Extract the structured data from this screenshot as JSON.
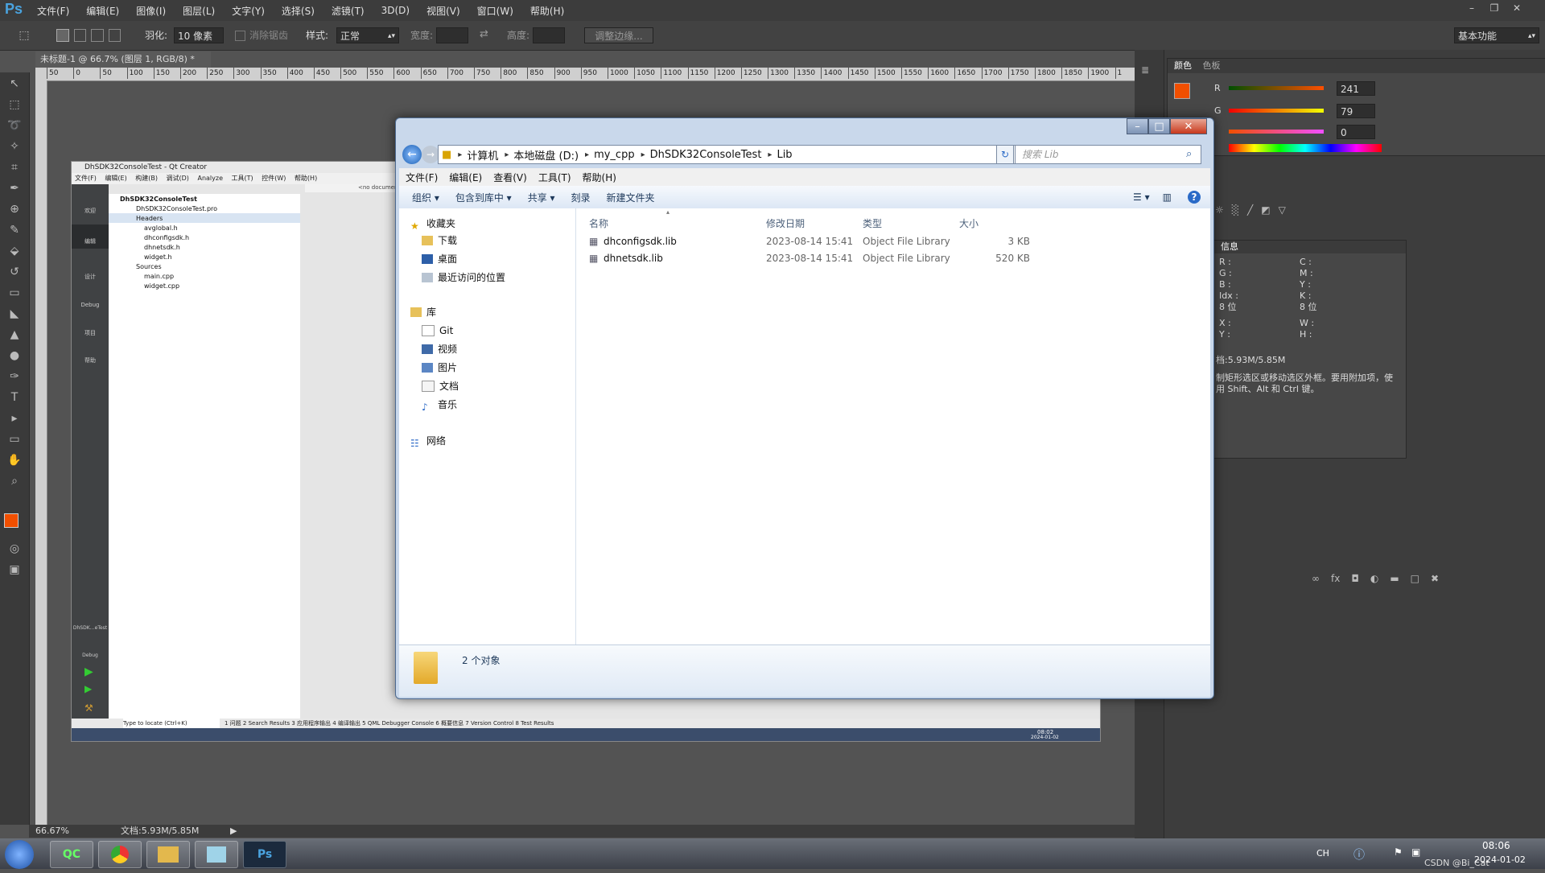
{
  "photoshop": {
    "logo": "Ps",
    "menus": [
      "文件(F)",
      "编辑(E)",
      "图像(I)",
      "图层(L)",
      "文字(Y)",
      "选择(S)",
      "滤镜(T)",
      "3D(D)",
      "视图(V)",
      "窗口(W)",
      "帮助(H)"
    ],
    "options": {
      "feather_label": "羽化:",
      "feather_value": "10 像素",
      "antialias_label": "消除锯齿",
      "style_label": "样式:",
      "style_value": "正常",
      "width_label": "宽度:",
      "height_label": "高度:",
      "refine_edge": "调整边缘...",
      "workspace": "基本功能"
    },
    "document_tab": "未标题-1 @ 66.7% (图层 1, RGB/8) *",
    "ruler_ticks": [
      "50",
      "0",
      "50",
      "100",
      "150",
      "200",
      "250",
      "300",
      "350",
      "400",
      "450",
      "500",
      "550",
      "600",
      "650",
      "700",
      "750",
      "800",
      "850",
      "900",
      "950",
      "1000",
      "1050",
      "1100",
      "1150",
      "1200",
      "1250",
      "1300",
      "1350",
      "1400",
      "1450",
      "1500",
      "1550",
      "1600",
      "1650",
      "1700",
      "1750",
      "1800",
      "1850",
      "1900",
      "1"
    ],
    "status_zoom": "66.67%",
    "status_doc": "文档:5.93M/5.85M",
    "color_panel": {
      "tabs": [
        "颜色",
        "色板"
      ],
      "r_label": "R",
      "r_value": "241",
      "g_label": "G",
      "g_value": "79",
      "b_value": "0",
      "foreground": "#f14f00"
    },
    "info_panel": {
      "tab": "信息",
      "rgb_labels": [
        "R :",
        "G :",
        "B :",
        "Idx :"
      ],
      "bit1": "8 位",
      "cmyk_labels": [
        "C :",
        "M :",
        "Y :",
        "K :"
      ],
      "bit2": "8 位",
      "xy_labels": [
        "X :",
        "Y :"
      ],
      "wh_labels": [
        "W :",
        "H :"
      ],
      "doc": "档:5.93M/5.85M",
      "hint": "制矩形选区或移动选区外框。要用附加项，使用 Shift、Alt 和 Ctrl 键。"
    }
  },
  "embedded": {
    "title": "DhSDK32ConsoleTest - Qt Creator",
    "menus": [
      "文件(F)",
      "编辑(E)",
      "构建(B)",
      "调试(D)",
      "Analyze",
      "工具(T)",
      "控件(W)",
      "帮助(H)"
    ],
    "tree": [
      "DhSDK32ConsoleTest",
      "DhSDK32ConsoleTest.pro",
      "Headers",
      "avglobal.h",
      "dhconfigsdk.h",
      "dhnetsdk.h",
      "widget.h",
      "Sources",
      "main.cpp",
      "widget.cpp"
    ],
    "doc_combo": "<no document>",
    "bottom_bar": "1 问题   2 Search Results   3 应用程序输出   4 编译输出   5 QML Debugger Console   6 概要信息   7 Version Control   8 Test Results",
    "locate": "Type to locate (Ctrl+K)",
    "clock_time": "08:02",
    "clock_date": "2024-01-02",
    "sidebar_labels": [
      "欢迎",
      "编辑",
      "设计",
      "Debug",
      "项目",
      "帮助",
      "DhSDK…eTest",
      "Debug"
    ]
  },
  "explorer": {
    "breadcrumb": [
      "计算机",
      "本地磁盘 (D:)",
      "my_cpp",
      "DhSDK32ConsoleTest",
      "Lib"
    ],
    "search_placeholder": "搜索 Lib",
    "menus": [
      "文件(F)",
      "编辑(E)",
      "查看(V)",
      "工具(T)",
      "帮助(H)"
    ],
    "commands": [
      "组织 ▾",
      "包含到库中 ▾",
      "共享 ▾",
      "刻录",
      "新建文件夹"
    ],
    "nav": {
      "favorites": "收藏夹",
      "fav_items": [
        "下载",
        "桌面",
        "最近访问的位置"
      ],
      "libraries": "库",
      "lib_items": [
        "Git",
        "视频",
        "图片",
        "文档",
        "音乐"
      ],
      "network": "网络"
    },
    "columns": [
      "名称",
      "修改日期",
      "类型",
      "大小"
    ],
    "files": [
      {
        "name": "dhconfigsdk.lib",
        "date": "2023-08-14 15:41",
        "type": "Object File Library",
        "size": "3 KB"
      },
      {
        "name": "dhnetsdk.lib",
        "date": "2023-08-14 15:41",
        "type": "Object File Library",
        "size": "520 KB"
      }
    ],
    "status": "2 个对象"
  },
  "taskbar": {
    "clock_time": "08:06",
    "clock_date": "2024-01-02",
    "lang": "CH",
    "watermark": "CSDN @Bi_Cat",
    "apps": [
      "QC",
      "Ps"
    ]
  }
}
